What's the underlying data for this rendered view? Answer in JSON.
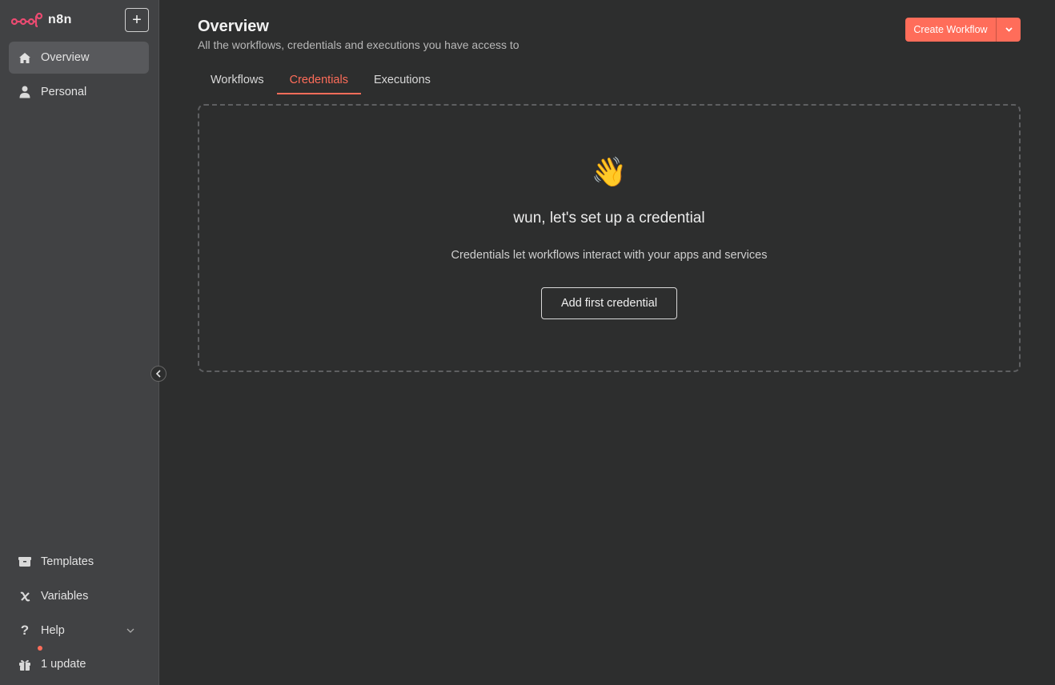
{
  "app": {
    "name": "n8n"
  },
  "sidebar": {
    "new_button": "+",
    "top_items": [
      {
        "label": "Overview",
        "icon": "home-icon",
        "active": true
      },
      {
        "label": "Personal",
        "icon": "user-icon",
        "active": false
      }
    ],
    "bottom_items": [
      {
        "label": "Templates",
        "icon": "box-icon"
      },
      {
        "label": "Variables",
        "icon": "variable-icon"
      },
      {
        "label": "Help",
        "icon": "question-icon"
      },
      {
        "label": "1 update",
        "icon": "gift-icon"
      }
    ]
  },
  "header": {
    "title": "Overview",
    "subtitle": "All the workflows, credentials and executions you have access to",
    "create_button": "Create Workflow"
  },
  "tabs": [
    {
      "label": "Workflows",
      "active": false
    },
    {
      "label": "Credentials",
      "active": true
    },
    {
      "label": "Executions",
      "active": false
    }
  ],
  "empty_state": {
    "emoji": "👋",
    "heading": "wun, let's set up a credential",
    "description": "Credentials let workflows interact with your apps and services",
    "button": "Add first credential"
  },
  "colors": {
    "accent": "#ff6d5a",
    "background": "#2d2e2e",
    "sidebar": "#414244"
  }
}
